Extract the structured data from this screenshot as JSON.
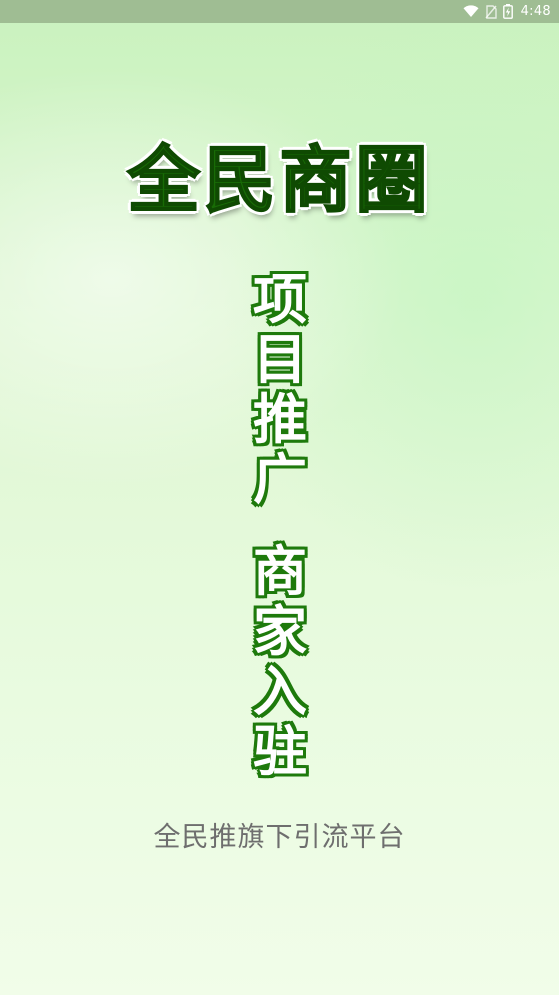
{
  "status_bar": {
    "time": "4:48",
    "icons": [
      "wifi-icon",
      "no-sim-icon",
      "battery-charging-icon"
    ]
  },
  "splash": {
    "title": "全民商圈",
    "slogan_1": [
      "项",
      "目",
      "推",
      "广"
    ],
    "slogan_2": [
      "商",
      "家",
      "入",
      "驻"
    ],
    "tagline": "全民推旗下引流平台"
  },
  "colors": {
    "title_fill": "#186b06",
    "slogan_outline": "#1e7a0c",
    "tagline_text": "#6e6e6e",
    "status_bar_bg": "#9fbd93",
    "background_top": "#c9f2be",
    "background_bottom": "#f1fde9"
  }
}
